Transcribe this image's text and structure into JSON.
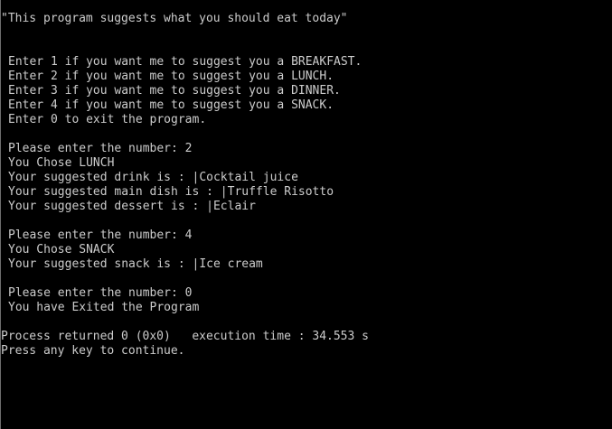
{
  "console": {
    "lines": [
      {
        "text": "\"This program suggests what you should eat today\"",
        "indent": false
      },
      {
        "text": "",
        "indent": false
      },
      {
        "text": "",
        "indent": false
      },
      {
        "text": "Enter 1 if you want me to suggest you a BREAKFAST.",
        "indent": true
      },
      {
        "text": "Enter 2 if you want me to suggest you a LUNCH.",
        "indent": true
      },
      {
        "text": "Enter 3 if you want me to suggest you a DINNER.",
        "indent": true
      },
      {
        "text": "Enter 4 if you want me to suggest you a SNACK.",
        "indent": true
      },
      {
        "text": "Enter 0 to exit the program.",
        "indent": true
      },
      {
        "text": "",
        "indent": false
      },
      {
        "text": "Please enter the number: 2",
        "indent": true
      },
      {
        "text": "You Chose LUNCH",
        "indent": true
      },
      {
        "text": "Your suggested drink is : |Cocktail juice",
        "indent": true
      },
      {
        "text": "Your suggested main dish is : |Truffle Risotto",
        "indent": true
      },
      {
        "text": "Your suggested dessert is : |Eclair",
        "indent": true
      },
      {
        "text": "",
        "indent": false
      },
      {
        "text": "Please enter the number: 4",
        "indent": true
      },
      {
        "text": "You Chose SNACK",
        "indent": true
      },
      {
        "text": "Your suggested snack is : |Ice cream",
        "indent": true
      },
      {
        "text": "",
        "indent": false
      },
      {
        "text": "Please enter the number: 0",
        "indent": true
      },
      {
        "text": "You have Exited the Program",
        "indent": true
      },
      {
        "text": "",
        "indent": false
      },
      {
        "text": "Process returned 0 (0x0)   execution time : 34.553 s",
        "indent": false
      },
      {
        "text": "Press any key to continue.",
        "indent": false
      }
    ]
  },
  "colors": {
    "background": "#000000",
    "text": "#cccccc"
  }
}
